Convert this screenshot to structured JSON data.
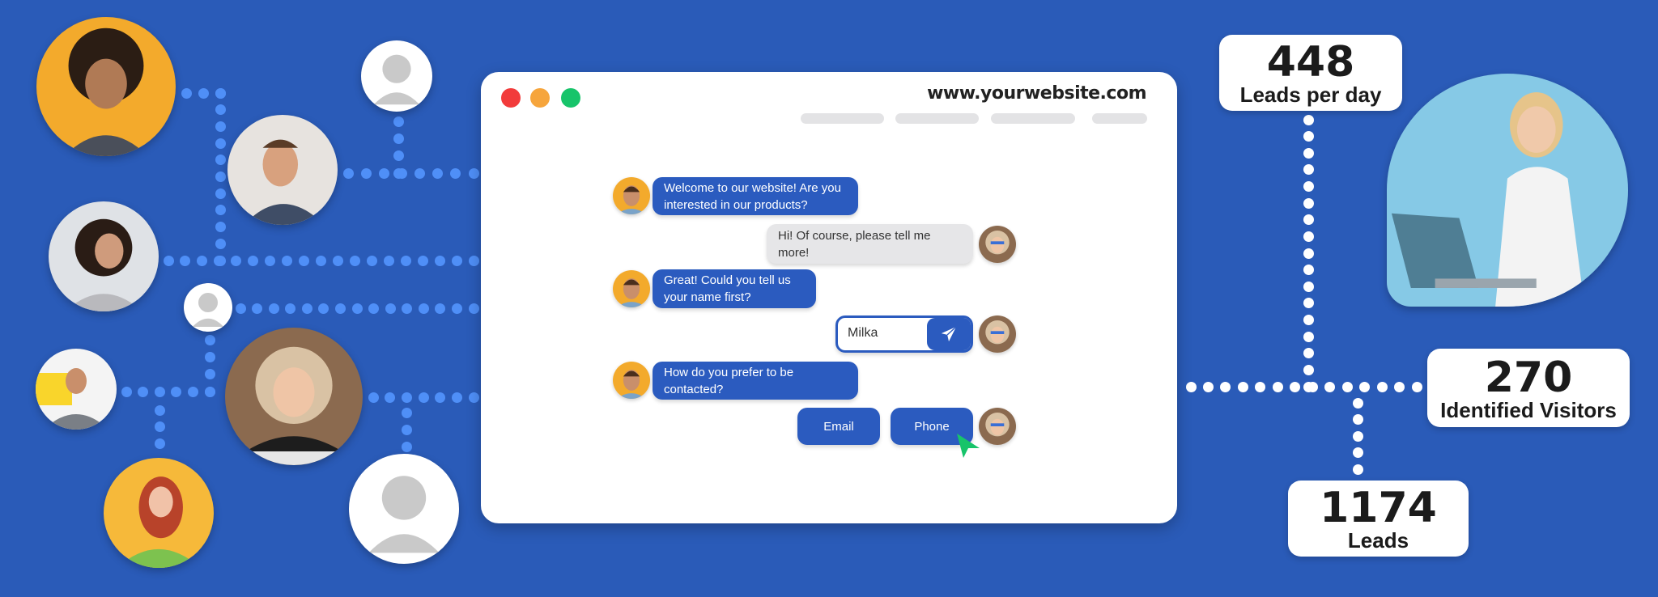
{
  "browser": {
    "url": "www.yourwebsite.com",
    "traffic_lights": [
      "#f23b3b",
      "#f6a53c",
      "#17c46a"
    ]
  },
  "chat": {
    "messages": [
      {
        "from": "bot",
        "text": "Welcome to our website! Are you interested in our products?"
      },
      {
        "from": "visitor",
        "text": "Hi! Of course, please tell me more!"
      },
      {
        "from": "bot",
        "text": "Great! Could you tell us your name first?"
      },
      {
        "from": "bot",
        "text": "How do you prefer to be contacted?"
      }
    ],
    "name_input_value": "Milka",
    "send_icon": "paper-plane-icon",
    "options": [
      "Email",
      "Phone"
    ],
    "accent_color": "#2b5bbf",
    "cursor_color": "#17c46a"
  },
  "stats": [
    {
      "value": "448",
      "label": "Leads per day"
    },
    {
      "value": "270",
      "label": "Identified Visitors"
    },
    {
      "value": "1174",
      "label": "Leads"
    }
  ],
  "colors": {
    "background": "#2a5bb8",
    "connector_dots": "#4f8ff7"
  }
}
